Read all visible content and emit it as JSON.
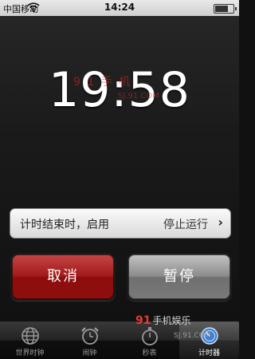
{
  "status_bar": {
    "carrier": "中国移动",
    "time": "14:24"
  },
  "timer": {
    "display": "19:58"
  },
  "watermark": {
    "main": "9 1 手 机",
    "sub": "SJ.91.COM"
  },
  "ends_row": {
    "label": "计时结束时，启用",
    "value": "停止运行"
  },
  "buttons": {
    "cancel": "取消",
    "pause": "暂停"
  },
  "tabs": [
    {
      "label": "世界时钟",
      "icon": "globe-icon",
      "active": false
    },
    {
      "label": "闹钟",
      "icon": "alarm-clock-icon",
      "active": false
    },
    {
      "label": "秒表",
      "icon": "stopwatch-icon",
      "active": false
    },
    {
      "label": "计时器",
      "icon": "timer-icon",
      "active": true
    }
  ],
  "corner_logo": {
    "number": "91",
    "brand": "手机娱乐",
    "url": "SJ.91.COM"
  },
  "colors": {
    "cancel": "#a31a1a",
    "pause": "#8c8c8c",
    "active_tab": "#ffffff"
  }
}
